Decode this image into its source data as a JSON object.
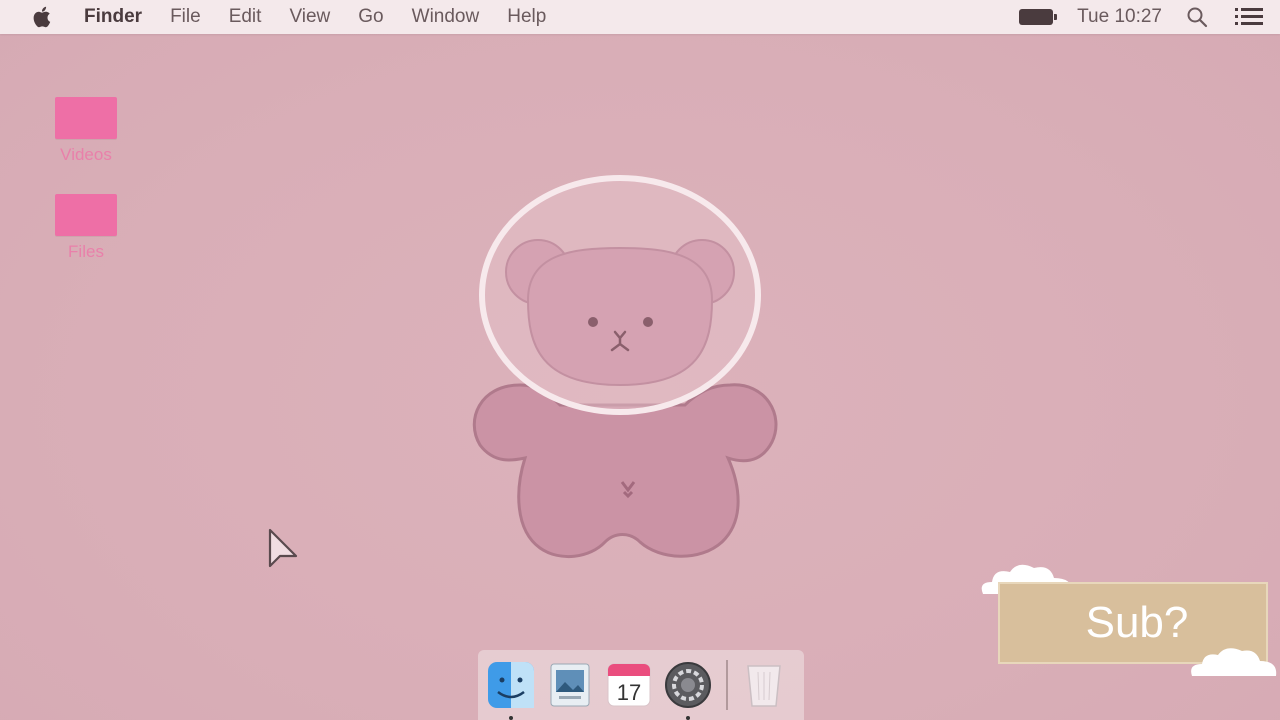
{
  "menubar": {
    "app_name": "Finder",
    "items": [
      "File",
      "Edit",
      "View",
      "Go",
      "Window",
      "Help"
    ],
    "clock": "Tue 10:27"
  },
  "desktop": {
    "icons": [
      {
        "label": "Videos"
      },
      {
        "label": "Files"
      }
    ]
  },
  "sticker": {
    "text": "Sub?"
  },
  "dock": {
    "apps": [
      "finder-icon",
      "preview-icon",
      "calendar-icon",
      "system-preferences-icon",
      "trash-icon"
    ],
    "calendar_day": "17"
  },
  "colors": {
    "wallpaper": "#dcb3bc",
    "folder": "#ee6fa6",
    "sticker": "#d8bf9c"
  }
}
